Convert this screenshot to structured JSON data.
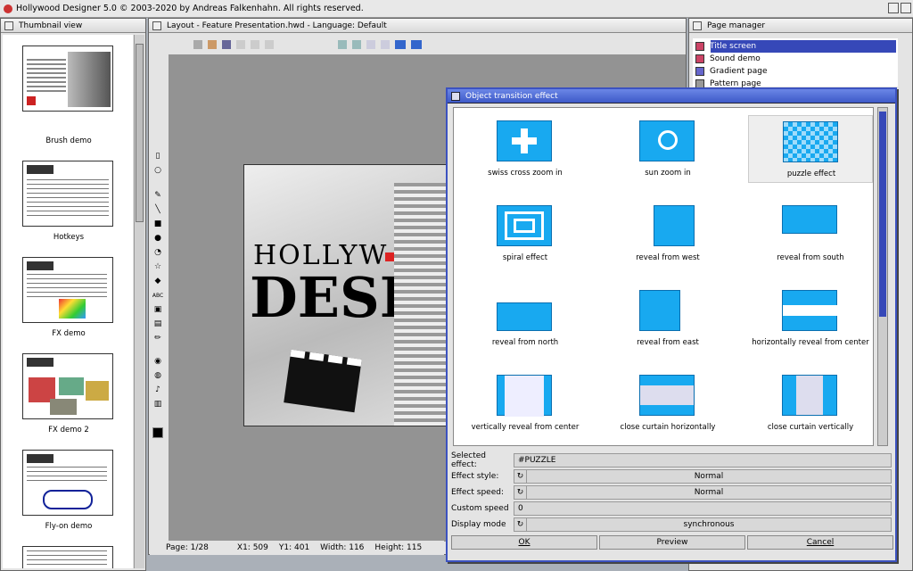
{
  "app": {
    "title": "Hollywood Designer 5.0 © 2003-2020 by Andreas Falkenhahn. All rights reserved."
  },
  "thumbnail_view": {
    "title": "Thumbnail view",
    "items": [
      {
        "label": "Brush demo"
      },
      {
        "label": "Hotkeys"
      },
      {
        "label": "FX demo"
      },
      {
        "label": "FX demo 2"
      },
      {
        "label": "Fly-on demo"
      }
    ]
  },
  "layout": {
    "title": "Layout - Feature Presentation.hwd - Language: Default",
    "slide_text_top": "HOLLYW",
    "slide_text_big": "DESIG",
    "status": {
      "page": "Page:  1/28",
      "x1": "X1:  509",
      "y1": "Y1:  401",
      "width": "Width:  116",
      "height": "Height:  115"
    }
  },
  "page_manager": {
    "title": "Page manager",
    "items": [
      "Title screen",
      "Sound demo",
      "Gradient page",
      "Pattern page"
    ]
  },
  "dialog": {
    "title": "Object transition effect",
    "effects": [
      {
        "label": "swiss cross zoom in"
      },
      {
        "label": "sun zoom in"
      },
      {
        "label": "puzzle effect"
      },
      {
        "label": "spiral effect"
      },
      {
        "label": "reveal from west"
      },
      {
        "label": "reveal from south"
      },
      {
        "label": "reveal from north"
      },
      {
        "label": "reveal from east"
      },
      {
        "label": "horizontally reveal from center"
      },
      {
        "label": "vertically reveal from center"
      },
      {
        "label": "close curtain horizontally"
      },
      {
        "label": "close curtain vertically"
      }
    ],
    "selected_effect": {
      "label": "Selected effect:",
      "value": "#PUZZLE"
    },
    "effect_style": {
      "label": "Effect style:",
      "value": "Normal"
    },
    "effect_speed": {
      "label": "Effect speed:",
      "value": "Normal"
    },
    "custom_speed": {
      "label": "Custom speed",
      "value": "0"
    },
    "display_mode": {
      "label": "Display mode",
      "value": "synchronous"
    },
    "ok": "OK",
    "preview": "Preview",
    "cancel": "Cancel"
  },
  "colors": {
    "dialog_title": "#3d59c8",
    "effect_icon": "#18a9f0",
    "selection": "#3648b8"
  }
}
